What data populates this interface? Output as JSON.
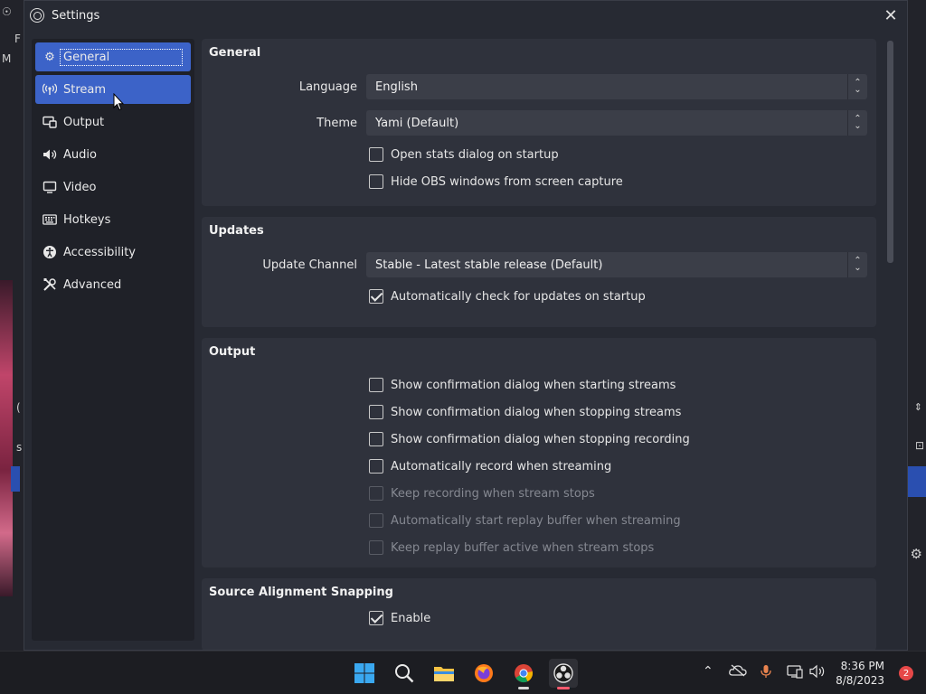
{
  "window": {
    "title": "Settings"
  },
  "sidebar": {
    "items": [
      {
        "label": "General",
        "icon": "gear-icon"
      },
      {
        "label": "Stream",
        "icon": "antenna-icon"
      },
      {
        "label": "Output",
        "icon": "output-icon"
      },
      {
        "label": "Audio",
        "icon": "speaker-icon"
      },
      {
        "label": "Video",
        "icon": "monitor-icon"
      },
      {
        "label": "Hotkeys",
        "icon": "keyboard-icon"
      },
      {
        "label": "Accessibility",
        "icon": "accessibility-icon"
      },
      {
        "label": "Advanced",
        "icon": "tools-icon"
      }
    ],
    "selected": "General",
    "hovered": "Stream"
  },
  "general": {
    "heading": "General",
    "language_label": "Language",
    "language_value": "English",
    "theme_label": "Theme",
    "theme_value": "Yami (Default)",
    "open_stats_label": "Open stats dialog on startup",
    "open_stats_checked": false,
    "hide_obs_label": "Hide OBS windows from screen capture",
    "hide_obs_checked": false
  },
  "updates": {
    "heading": "Updates",
    "channel_label": "Update Channel",
    "channel_value": "Stable - Latest stable release (Default)",
    "auto_check_label": "Automatically check for updates on startup",
    "auto_check_checked": true
  },
  "output": {
    "heading": "Output",
    "options": [
      {
        "label": "Show confirmation dialog when starting streams",
        "checked": false,
        "enabled": true
      },
      {
        "label": "Show confirmation dialog when stopping streams",
        "checked": false,
        "enabled": true
      },
      {
        "label": "Show confirmation dialog when stopping recording",
        "checked": false,
        "enabled": true
      },
      {
        "label": "Automatically record when streaming",
        "checked": false,
        "enabled": true
      },
      {
        "label": "Keep recording when stream stops",
        "checked": false,
        "enabled": false
      },
      {
        "label": "Automatically start replay buffer when streaming",
        "checked": false,
        "enabled": false
      },
      {
        "label": "Keep replay buffer active when stream stops",
        "checked": false,
        "enabled": false
      }
    ]
  },
  "snapping": {
    "heading": "Source Alignment Snapping",
    "enable_label": "Enable",
    "enable_checked": true
  },
  "taskbar": {
    "apps": [
      "windows-start-icon",
      "search-icon",
      "file-explorer-icon",
      "firefox-icon",
      "chrome-icon",
      "obs-icon"
    ],
    "time": "8:36 PM",
    "date": "8/8/2023",
    "notification_count": "2"
  }
}
